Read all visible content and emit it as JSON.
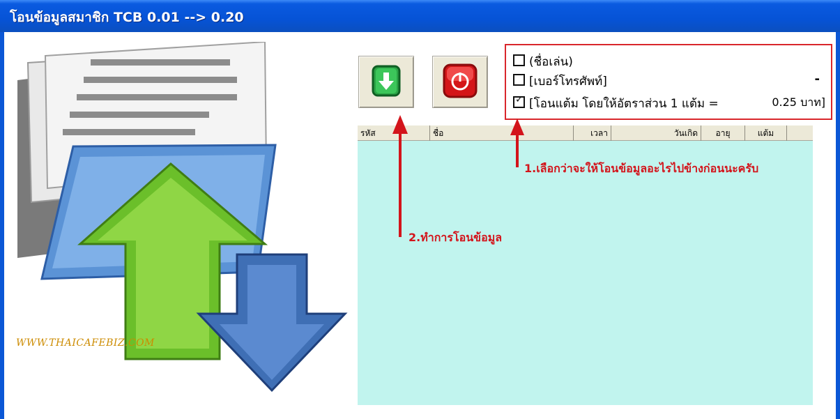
{
  "window": {
    "title": "โอนข้อมูลสมาชิก TCB 0.01 --> 0.20"
  },
  "watermark": "WWW.THAICAFEBIZ.COM",
  "options": {
    "opt1_label": "(ชื่อเล่น)",
    "opt1_checked": false,
    "opt2_label": "[เบอร์โทรศัพท์]",
    "opt2_checked": false,
    "opt2_suffix": "-",
    "opt3_label": "[โอนแต้ม โดยให้อัตราส่วน 1 แต้ม =",
    "opt3_checked": true,
    "opt3_rate": "0.25 บาท]"
  },
  "grid": {
    "columns": [
      "รหัส",
      "ชื่อ",
      "เวลา",
      "วันเกิด",
      "อายุ",
      "แต้ม"
    ],
    "background": "#c1f4ee",
    "rows": []
  },
  "annotations": {
    "step1": "1.เลือกว่าจะให้โอนข้อมูลอะไรไปข้างก่อนนะครับ",
    "step2": "2.ทำการโอนข้อมูล",
    "color": "#d3141b"
  },
  "buttons": {
    "download_icon": "download-arrow-icon",
    "stop_icon": "power-stop-icon"
  }
}
